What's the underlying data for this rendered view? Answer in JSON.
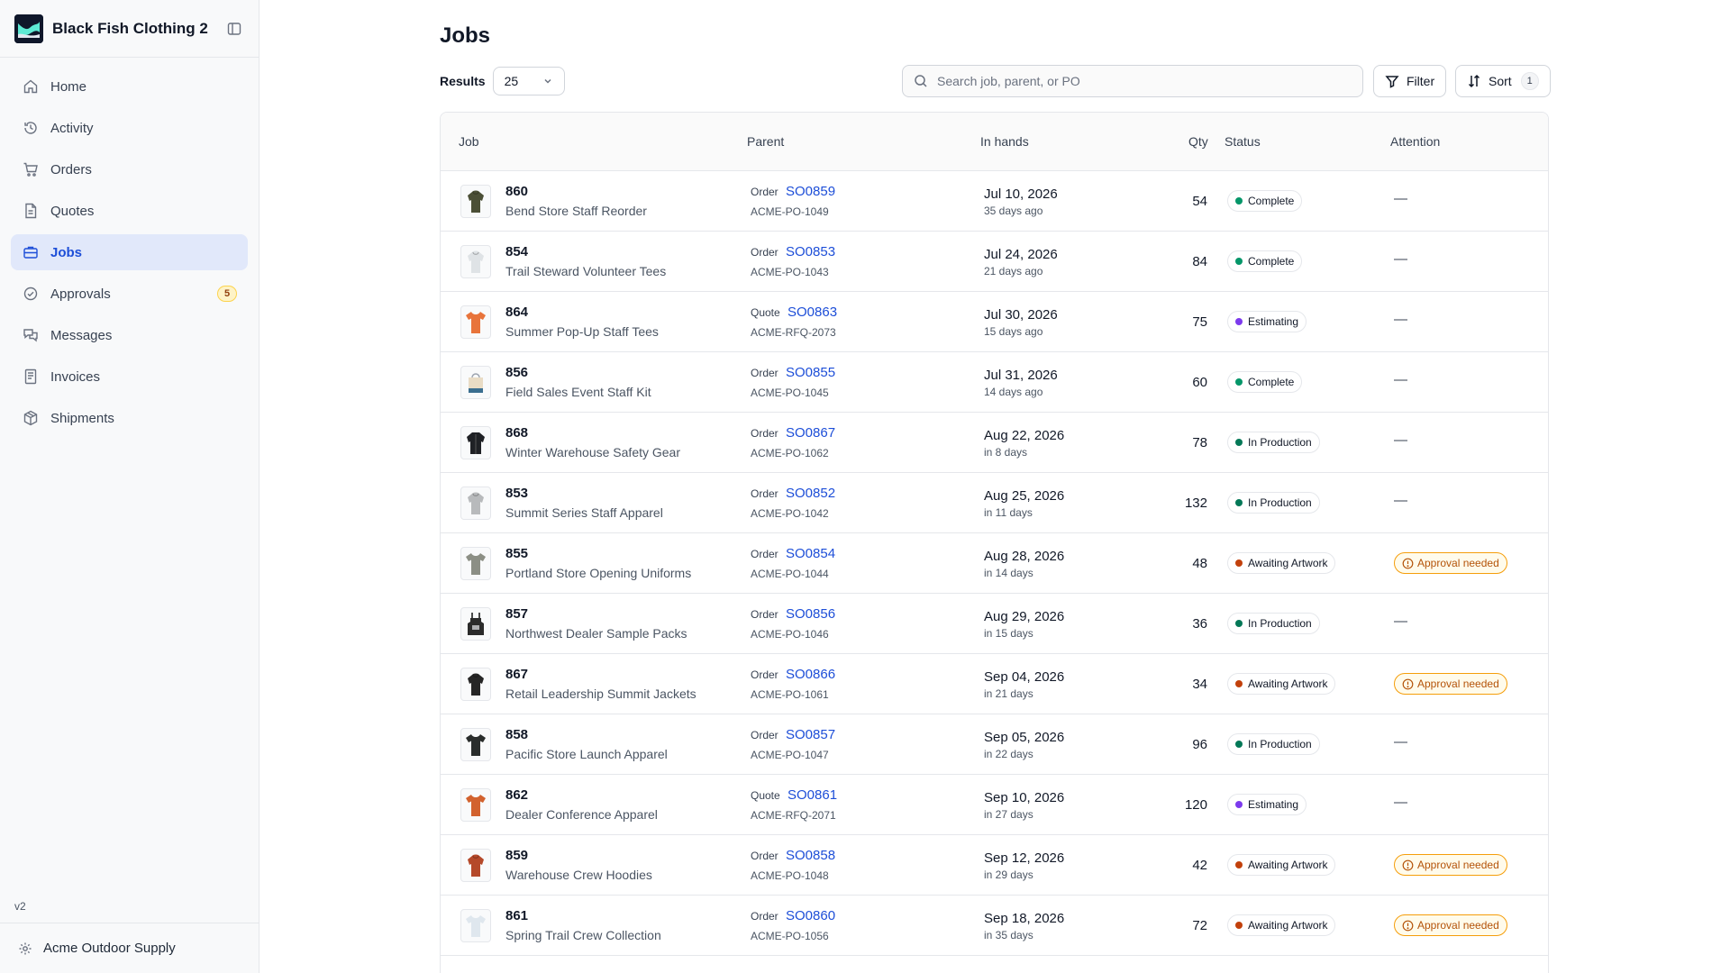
{
  "sidebar": {
    "brand": "Black Fish Clothing 2",
    "items": [
      {
        "label": "Home",
        "icon": "home-icon",
        "active": false
      },
      {
        "label": "Activity",
        "icon": "history-icon",
        "active": false
      },
      {
        "label": "Orders",
        "icon": "cart-icon",
        "active": false
      },
      {
        "label": "Quotes",
        "icon": "document-icon",
        "active": false
      },
      {
        "label": "Jobs",
        "icon": "briefcase-icon",
        "active": true
      },
      {
        "label": "Approvals",
        "icon": "check-circle-icon",
        "active": false,
        "badge": "5"
      },
      {
        "label": "Messages",
        "icon": "messages-icon",
        "active": false
      },
      {
        "label": "Invoices",
        "icon": "invoice-icon",
        "active": false
      },
      {
        "label": "Shipments",
        "icon": "package-icon",
        "active": false
      }
    ],
    "version": "v2",
    "org": "Acme Outdoor Supply"
  },
  "page": {
    "title": "Jobs",
    "results_label": "Results",
    "results_value": "25",
    "search_placeholder": "Search job, parent, or PO",
    "filter_label": "Filter",
    "sort_label": "Sort",
    "sort_count": "1"
  },
  "table": {
    "columns": {
      "job": "Job",
      "parent": "Parent",
      "in_hands": "In hands",
      "qty": "Qty",
      "status": "Status",
      "attention": "Attention"
    },
    "rows": [
      {
        "job": "860",
        "name": "Bend Store Staff Reorder",
        "parent_type": "Order",
        "parent_id": "SO0859",
        "po": "ACME-PO-1049",
        "date": "Jul 10, 2026",
        "rel": "35 days ago",
        "qty": "54",
        "status": "Complete",
        "status_color": "#059669",
        "attention": "—",
        "thumb": "#4b4f36",
        "thumb_kind": "hoodie"
      },
      {
        "job": "854",
        "name": "Trail Steward Volunteer Tees",
        "parent_type": "Order",
        "parent_id": "SO0853",
        "po": "ACME-PO-1043",
        "date": "Jul 24, 2026",
        "rel": "21 days ago",
        "qty": "84",
        "status": "Complete",
        "status_color": "#059669",
        "attention": "—",
        "thumb": "#dfe3e6",
        "thumb_kind": "hoodie"
      },
      {
        "job": "864",
        "name": "Summer Pop-Up Staff Tees",
        "parent_type": "Quote",
        "parent_id": "SO0863",
        "po": "ACME-RFQ-2073",
        "date": "Jul 30, 2026",
        "rel": "15 days ago",
        "qty": "75",
        "status": "Estimating",
        "status_color": "#7c3aed",
        "attention": "—",
        "thumb": "#e8743b",
        "thumb_kind": "tee"
      },
      {
        "job": "856",
        "name": "Field Sales Event Staff Kit",
        "parent_type": "Order",
        "parent_id": "SO0855",
        "po": "ACME-PO-1045",
        "date": "Jul 31, 2026",
        "rel": "14 days ago",
        "qty": "60",
        "status": "Complete",
        "status_color": "#059669",
        "attention": "—",
        "thumb": "#e9dcc5",
        "thumb_kind": "bag"
      },
      {
        "job": "868",
        "name": "Winter Warehouse Safety Gear",
        "parent_type": "Order",
        "parent_id": "SO0867",
        "po": "ACME-PO-1062",
        "date": "Aug 22, 2026",
        "rel": "in 8 days",
        "qty": "78",
        "status": "In Production",
        "status_color": "#047857",
        "attention": "—",
        "thumb": "#1f2125",
        "thumb_kind": "jacket"
      },
      {
        "job": "853",
        "name": "Summit Series Staff Apparel",
        "parent_type": "Order",
        "parent_id": "SO0852",
        "po": "ACME-PO-1042",
        "date": "Aug 25, 2026",
        "rel": "in 11 days",
        "qty": "132",
        "status": "In Production",
        "status_color": "#047857",
        "attention": "—",
        "thumb": "#b8babc",
        "thumb_kind": "hoodie"
      },
      {
        "job": "855",
        "name": "Portland Store Opening Uniforms",
        "parent_type": "Order",
        "parent_id": "SO0854",
        "po": "ACME-PO-1044",
        "date": "Aug 28, 2026",
        "rel": "in 14 days",
        "qty": "48",
        "status": "Awaiting Artwork",
        "status_color": "#c2410c",
        "attention": "Approval needed",
        "thumb": "#8c8f85",
        "thumb_kind": "tee"
      },
      {
        "job": "857",
        "name": "Northwest Dealer Sample Packs",
        "parent_type": "Order",
        "parent_id": "SO0856",
        "po": "ACME-PO-1046",
        "date": "Aug 29, 2026",
        "rel": "in 15 days",
        "qty": "36",
        "status": "In Production",
        "status_color": "#047857",
        "attention": "—",
        "thumb": "#2b2b2b",
        "thumb_kind": "apron"
      },
      {
        "job": "867",
        "name": "Retail Leadership Summit Jackets",
        "parent_type": "Order",
        "parent_id": "SO0866",
        "po": "ACME-PO-1061",
        "date": "Sep 04, 2026",
        "rel": "in 21 days",
        "qty": "34",
        "status": "Awaiting Artwork",
        "status_color": "#c2410c",
        "attention": "Approval needed",
        "thumb": "#262626",
        "thumb_kind": "hoodie"
      },
      {
        "job": "858",
        "name": "Pacific Store Launch Apparel",
        "parent_type": "Order",
        "parent_id": "SO0857",
        "po": "ACME-PO-1047",
        "date": "Sep 05, 2026",
        "rel": "in 22 days",
        "qty": "96",
        "status": "In Production",
        "status_color": "#047857",
        "attention": "—",
        "thumb": "#2a2d2c",
        "thumb_kind": "tee"
      },
      {
        "job": "862",
        "name": "Dealer Conference Apparel",
        "parent_type": "Quote",
        "parent_id": "SO0861",
        "po": "ACME-RFQ-2071",
        "date": "Sep 10, 2026",
        "rel": "in 27 days",
        "qty": "120",
        "status": "Estimating",
        "status_color": "#7c3aed",
        "attention": "—",
        "thumb": "#d2622e",
        "thumb_kind": "tee"
      },
      {
        "job": "859",
        "name": "Warehouse Crew Hoodies",
        "parent_type": "Order",
        "parent_id": "SO0858",
        "po": "ACME-PO-1048",
        "date": "Sep 12, 2026",
        "rel": "in 29 days",
        "qty": "42",
        "status": "Awaiting Artwork",
        "status_color": "#c2410c",
        "attention": "Approval needed",
        "thumb": "#b5492a",
        "thumb_kind": "hoodie"
      },
      {
        "job": "861",
        "name": "Spring Trail Crew Collection",
        "parent_type": "Order",
        "parent_id": "SO0860",
        "po": "ACME-PO-1056",
        "date": "Sep 18, 2026",
        "rel": "in 35 days",
        "qty": "72",
        "status": "Awaiting Artwork",
        "status_color": "#c2410c",
        "attention": "Approval needed",
        "thumb": "#dfe7ee",
        "thumb_kind": "tee"
      }
    ]
  }
}
